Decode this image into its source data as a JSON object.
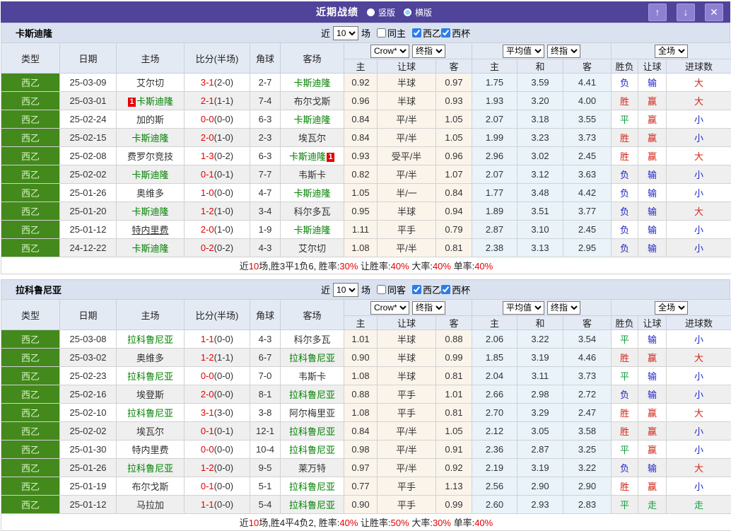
{
  "titlebar": {
    "title": "近期战绩",
    "layout_vertical": "竖版",
    "layout_horizontal": "横版",
    "buttons": {
      "up": "↑",
      "down": "↓",
      "close": "✕"
    }
  },
  "controls_labels": {
    "near": "近",
    "matches": "场",
    "league": "西乙",
    "cup": "西杯"
  },
  "table_header": {
    "left_columns": [
      "类型",
      "日期",
      "主场",
      "比分(半场)",
      "角球",
      "客场"
    ],
    "selects": {
      "company": "Crow*",
      "company_time": "终指",
      "average": "平均值",
      "average_time": "终指",
      "scope": "全场"
    },
    "sub_columns": [
      "主",
      "让球",
      "客",
      "主",
      "和",
      "客",
      "胜负",
      "让球",
      "进球数"
    ]
  },
  "colors": {
    "titlebar_purple": "#50439a",
    "button_purple": "#8d80d2",
    "teambar_blue": "#dae2f0",
    "header_blue": "#e4eaf4",
    "type_green": "#43891c",
    "odds_beige": "#fbf4eb",
    "avg_blue": "#e9f3f9",
    "team_green": "#008000",
    "score_red": "#e60000",
    "result_red": "#d42517",
    "result_blue": "#2126c4",
    "result_green": "#169b3f",
    "checkbox_blue": "#2b7de9"
  },
  "sections": [
    {
      "team": "卡斯迪隆",
      "near_count": "10",
      "same_filter_label": "同主",
      "filters": {
        "same": false,
        "league": true,
        "cup": true
      },
      "rows": [
        {
          "league": "西乙",
          "date": "25-03-09",
          "home": {
            "name": "艾尔切"
          },
          "score": {
            "full": "3-1",
            "half": "(2-0)"
          },
          "corner": "2-7",
          "away": {
            "name": "卡斯迪隆",
            "green": true
          },
          "odds": [
            "0.92",
            "半球",
            "0.97"
          ],
          "avg": [
            "1.75",
            "3.59",
            "4.41"
          ],
          "outcome": [
            [
              "负",
              "blue"
            ],
            [
              "输",
              "blue"
            ],
            [
              "大",
              "red"
            ]
          ]
        },
        {
          "league": "西乙",
          "date": "25-03-01",
          "home": {
            "name": "卡斯迪隆",
            "green": true,
            "badge_before": "1"
          },
          "score": {
            "full": "2-1",
            "half": "(1-1)"
          },
          "corner": "7-4",
          "away": {
            "name": "布尔戈斯"
          },
          "odds": [
            "0.96",
            "半球",
            "0.93"
          ],
          "avg": [
            "1.93",
            "3.20",
            "4.00"
          ],
          "outcome": [
            [
              "胜",
              "red"
            ],
            [
              "赢",
              "red"
            ],
            [
              "大",
              "red"
            ]
          ]
        },
        {
          "league": "西乙",
          "date": "25-02-24",
          "home": {
            "name": "加的斯"
          },
          "score": {
            "full": "0-0",
            "half": "(0-0)"
          },
          "corner": "6-3",
          "away": {
            "name": "卡斯迪隆",
            "green": true
          },
          "odds": [
            "0.84",
            "平/半",
            "1.05"
          ],
          "avg": [
            "2.07",
            "3.18",
            "3.55"
          ],
          "outcome": [
            [
              "平",
              "green"
            ],
            [
              "赢",
              "red"
            ],
            [
              "小",
              "blue"
            ]
          ]
        },
        {
          "league": "西乙",
          "date": "25-02-15",
          "home": {
            "name": "卡斯迪隆",
            "green": true
          },
          "score": {
            "full": "2-0",
            "half": "(1-0)"
          },
          "corner": "2-3",
          "away": {
            "name": "埃瓦尔"
          },
          "odds": [
            "0.84",
            "平/半",
            "1.05"
          ],
          "avg": [
            "1.99",
            "3.23",
            "3.73"
          ],
          "outcome": [
            [
              "胜",
              "red"
            ],
            [
              "赢",
              "red"
            ],
            [
              "小",
              "blue"
            ]
          ]
        },
        {
          "league": "西乙",
          "date": "25-02-08",
          "home": {
            "name": "费罗尔竞技"
          },
          "score": {
            "full": "1-3",
            "half": "(0-2)"
          },
          "corner": "6-3",
          "away": {
            "name": "卡斯迪隆",
            "green": true,
            "badge_after": "1"
          },
          "odds": [
            "0.93",
            "受平/半",
            "0.96"
          ],
          "avg": [
            "2.96",
            "3.02",
            "2.45"
          ],
          "outcome": [
            [
              "胜",
              "red"
            ],
            [
              "赢",
              "red"
            ],
            [
              "大",
              "red"
            ]
          ]
        },
        {
          "league": "西乙",
          "date": "25-02-02",
          "home": {
            "name": "卡斯迪隆",
            "green": true
          },
          "score": {
            "full": "0-1",
            "half": "(0-1)"
          },
          "corner": "7-7",
          "away": {
            "name": "韦斯卡"
          },
          "odds": [
            "0.82",
            "平/半",
            "1.07"
          ],
          "avg": [
            "2.07",
            "3.12",
            "3.63"
          ],
          "outcome": [
            [
              "负",
              "blue"
            ],
            [
              "输",
              "blue"
            ],
            [
              "小",
              "blue"
            ]
          ]
        },
        {
          "league": "西乙",
          "date": "25-01-26",
          "home": {
            "name": "奥维多"
          },
          "score": {
            "full": "1-0",
            "half": "(0-0)"
          },
          "corner": "4-7",
          "away": {
            "name": "卡斯迪隆",
            "green": true
          },
          "odds": [
            "1.05",
            "半/一",
            "0.84"
          ],
          "avg": [
            "1.77",
            "3.48",
            "4.42"
          ],
          "outcome": [
            [
              "负",
              "blue"
            ],
            [
              "输",
              "blue"
            ],
            [
              "小",
              "blue"
            ]
          ]
        },
        {
          "league": "西乙",
          "date": "25-01-20",
          "home": {
            "name": "卡斯迪隆",
            "green": true
          },
          "score": {
            "full": "1-2",
            "half": "(1-0)"
          },
          "corner": "3-4",
          "away": {
            "name": "科尔多瓦"
          },
          "odds": [
            "0.95",
            "半球",
            "0.94"
          ],
          "avg": [
            "1.89",
            "3.51",
            "3.77"
          ],
          "outcome": [
            [
              "负",
              "blue"
            ],
            [
              "输",
              "blue"
            ],
            [
              "大",
              "red"
            ]
          ]
        },
        {
          "league": "西乙",
          "date": "25-01-12",
          "home": {
            "name": "特内里费",
            "underline": true
          },
          "score": {
            "full": "2-0",
            "half": "(1-0)"
          },
          "corner": "1-9",
          "away": {
            "name": "卡斯迪隆",
            "green": true
          },
          "odds": [
            "1.11",
            "平手",
            "0.79"
          ],
          "avg": [
            "2.87",
            "3.10",
            "2.45"
          ],
          "outcome": [
            [
              "负",
              "blue"
            ],
            [
              "输",
              "blue"
            ],
            [
              "小",
              "blue"
            ]
          ]
        },
        {
          "league": "西乙",
          "date": "24-12-22",
          "home": {
            "name": "卡斯迪隆",
            "green": true
          },
          "score": {
            "full": "0-2",
            "half": "(0-2)"
          },
          "corner": "4-3",
          "away": {
            "name": "艾尔切"
          },
          "odds": [
            "1.08",
            "平/半",
            "0.81"
          ],
          "avg": [
            "2.38",
            "3.13",
            "2.95"
          ],
          "outcome": [
            [
              "负",
              "blue"
            ],
            [
              "输",
              "blue"
            ],
            [
              "小",
              "blue"
            ]
          ]
        }
      ],
      "summary": [
        [
          "近",
          "dark"
        ],
        [
          "10",
          "red"
        ],
        [
          "场,胜3平1负6, 胜率:",
          "dark"
        ],
        [
          "30%",
          "red"
        ],
        [
          " 让胜率:",
          "dark"
        ],
        [
          "40%",
          "red"
        ],
        [
          " 大率:",
          "dark"
        ],
        [
          "40%",
          "red"
        ],
        [
          " 单率:",
          "dark"
        ],
        [
          "40%",
          "red"
        ]
      ]
    },
    {
      "team": "拉科鲁尼亚",
      "near_count": "10",
      "same_filter_label": "同客",
      "filters": {
        "same": false,
        "league": true,
        "cup": true
      },
      "rows": [
        {
          "league": "西乙",
          "date": "25-03-08",
          "home": {
            "name": "拉科鲁尼亚",
            "green": true
          },
          "score": {
            "full": "1-1",
            "half": "(0-0)"
          },
          "corner": "4-3",
          "away": {
            "name": "科尔多瓦"
          },
          "odds": [
            "1.01",
            "半球",
            "0.88"
          ],
          "avg": [
            "2.06",
            "3.22",
            "3.54"
          ],
          "outcome": [
            [
              "平",
              "green"
            ],
            [
              "输",
              "blue"
            ],
            [
              "小",
              "blue"
            ]
          ]
        },
        {
          "league": "西乙",
          "date": "25-03-02",
          "home": {
            "name": "奥维多"
          },
          "score": {
            "full": "1-2",
            "half": "(1-1)"
          },
          "corner": "6-7",
          "away": {
            "name": "拉科鲁尼亚",
            "green": true
          },
          "odds": [
            "0.90",
            "半球",
            "0.99"
          ],
          "avg": [
            "1.85",
            "3.19",
            "4.46"
          ],
          "outcome": [
            [
              "胜",
              "red"
            ],
            [
              "赢",
              "red"
            ],
            [
              "大",
              "red"
            ]
          ]
        },
        {
          "league": "西乙",
          "date": "25-02-23",
          "home": {
            "name": "拉科鲁尼亚",
            "green": true
          },
          "score": {
            "full": "0-0",
            "half": "(0-0)"
          },
          "corner": "7-0",
          "away": {
            "name": "韦斯卡"
          },
          "odds": [
            "1.08",
            "半球",
            "0.81"
          ],
          "avg": [
            "2.04",
            "3.11",
            "3.73"
          ],
          "outcome": [
            [
              "平",
              "green"
            ],
            [
              "输",
              "blue"
            ],
            [
              "小",
              "blue"
            ]
          ]
        },
        {
          "league": "西乙",
          "date": "25-02-16",
          "home": {
            "name": "埃登斯"
          },
          "score": {
            "full": "2-0",
            "half": "(0-0)"
          },
          "corner": "8-1",
          "away": {
            "name": "拉科鲁尼亚",
            "green": true
          },
          "odds": [
            "0.88",
            "平手",
            "1.01"
          ],
          "avg": [
            "2.66",
            "2.98",
            "2.72"
          ],
          "outcome": [
            [
              "负",
              "blue"
            ],
            [
              "输",
              "blue"
            ],
            [
              "小",
              "blue"
            ]
          ]
        },
        {
          "league": "西乙",
          "date": "25-02-10",
          "home": {
            "name": "拉科鲁尼亚",
            "green": true
          },
          "score": {
            "full": "3-1",
            "half": "(3-0)"
          },
          "corner": "3-8",
          "away": {
            "name": "阿尔梅里亚"
          },
          "odds": [
            "1.08",
            "平手",
            "0.81"
          ],
          "avg": [
            "2.70",
            "3.29",
            "2.47"
          ],
          "outcome": [
            [
              "胜",
              "red"
            ],
            [
              "赢",
              "red"
            ],
            [
              "大",
              "red"
            ]
          ]
        },
        {
          "league": "西乙",
          "date": "25-02-02",
          "home": {
            "name": "埃瓦尔"
          },
          "score": {
            "full": "0-1",
            "half": "(0-1)"
          },
          "corner": "12-1",
          "away": {
            "name": "拉科鲁尼亚",
            "green": true
          },
          "odds": [
            "0.84",
            "平/半",
            "1.05"
          ],
          "avg": [
            "2.12",
            "3.05",
            "3.58"
          ],
          "outcome": [
            [
              "胜",
              "red"
            ],
            [
              "赢",
              "red"
            ],
            [
              "小",
              "blue"
            ]
          ]
        },
        {
          "league": "西乙",
          "date": "25-01-30",
          "home": {
            "name": "特内里费"
          },
          "score": {
            "full": "0-0",
            "half": "(0-0)"
          },
          "corner": "10-4",
          "away": {
            "name": "拉科鲁尼亚",
            "green": true
          },
          "odds": [
            "0.98",
            "平/半",
            "0.91"
          ],
          "avg": [
            "2.36",
            "2.87",
            "3.25"
          ],
          "outcome": [
            [
              "平",
              "green"
            ],
            [
              "赢",
              "red"
            ],
            [
              "小",
              "blue"
            ]
          ]
        },
        {
          "league": "西乙",
          "date": "25-01-26",
          "home": {
            "name": "拉科鲁尼亚",
            "green": true
          },
          "score": {
            "full": "1-2",
            "half": "(0-0)"
          },
          "corner": "9-5",
          "away": {
            "name": "莱万特"
          },
          "odds": [
            "0.97",
            "平/半",
            "0.92"
          ],
          "avg": [
            "2.19",
            "3.19",
            "3.22"
          ],
          "outcome": [
            [
              "负",
              "blue"
            ],
            [
              "输",
              "blue"
            ],
            [
              "大",
              "red"
            ]
          ]
        },
        {
          "league": "西乙",
          "date": "25-01-19",
          "home": {
            "name": "布尔戈斯"
          },
          "score": {
            "full": "0-1",
            "half": "(0-0)"
          },
          "corner": "5-1",
          "away": {
            "name": "拉科鲁尼亚",
            "green": true
          },
          "odds": [
            "0.77",
            "平手",
            "1.13"
          ],
          "avg": [
            "2.56",
            "2.90",
            "2.90"
          ],
          "outcome": [
            [
              "胜",
              "red"
            ],
            [
              "赢",
              "red"
            ],
            [
              "小",
              "blue"
            ]
          ]
        },
        {
          "league": "西乙",
          "date": "25-01-12",
          "home": {
            "name": "马拉加"
          },
          "score": {
            "full": "1-1",
            "half": "(0-0)"
          },
          "corner": "5-4",
          "away": {
            "name": "拉科鲁尼亚",
            "green": true
          },
          "odds": [
            "0.90",
            "平手",
            "0.99"
          ],
          "avg": [
            "2.60",
            "2.93",
            "2.83"
          ],
          "outcome": [
            [
              "平",
              "green"
            ],
            [
              "走",
              "green"
            ],
            [
              "走",
              "green"
            ]
          ]
        }
      ],
      "summary": [
        [
          "近",
          "dark"
        ],
        [
          "10",
          "red"
        ],
        [
          "场,胜4平4负2, 胜率:",
          "dark"
        ],
        [
          "40%",
          "red"
        ],
        [
          " 让胜率:",
          "dark"
        ],
        [
          "50%",
          "red"
        ],
        [
          " 大率:",
          "dark"
        ],
        [
          "30%",
          "red"
        ],
        [
          " 单率:",
          "dark"
        ],
        [
          "40%",
          "red"
        ]
      ]
    }
  ]
}
